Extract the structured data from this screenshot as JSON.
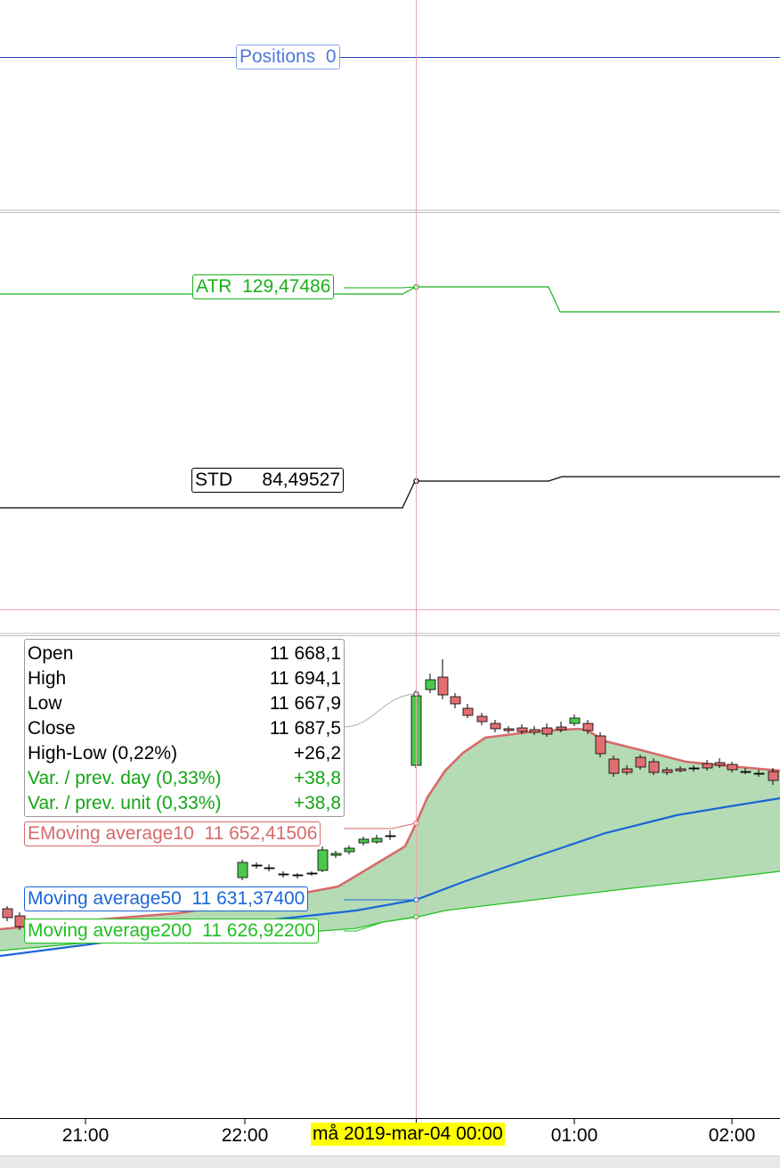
{
  "colors": {
    "positions": "#4f79d8",
    "atr": "#19b219",
    "std": "#000000",
    "ema10": "#d76a6a",
    "ma50": "#1a66d6",
    "ma200": "#1fbf1f",
    "fill": "#b5dbb5",
    "bull": "#4cc84c",
    "bear": "#e06f72",
    "crosshair": "#e7a8b4",
    "date_highlight": "#ffff00"
  },
  "panels": {
    "positions": {
      "label": "Positions",
      "value": "0"
    },
    "atr": {
      "label": "ATR",
      "value": "129,47486"
    },
    "std": {
      "label": "STD",
      "value": "84,49527"
    }
  },
  "ohlc_box": {
    "rows": [
      {
        "label": "Open",
        "value": "11 668,1",
        "style": "normal"
      },
      {
        "label": "High",
        "value": "11 694,1",
        "style": "normal"
      },
      {
        "label": "Low",
        "value": "11 667,9",
        "style": "normal"
      },
      {
        "label": "Close",
        "value": "11 687,5",
        "style": "normal"
      },
      {
        "label": "High-Low (0,22%)",
        "value": "+26,2",
        "style": "normal"
      },
      {
        "label": "Var. / prev. day (0,33%)",
        "value": "+38,8",
        "style": "green"
      },
      {
        "label": "Var. / prev. unit (0,33%)",
        "value": "+38,8",
        "style": "green"
      }
    ]
  },
  "indicators": {
    "ema10": {
      "label": "EMoving average10",
      "value": "11 652,41506"
    },
    "ma50": {
      "label": "Moving average50",
      "value": "11 631,37400"
    },
    "ma200": {
      "label": "Moving average200",
      "value": "11 626,92200"
    }
  },
  "time_axis": {
    "ticks": [
      "21:00",
      "22:00",
      "01:00",
      "02:00"
    ],
    "crosshair_date": "må 2019-mar-04 00:00"
  },
  "chart_data": {
    "type": "candlestick",
    "selected": {
      "open": 11668.1,
      "high": 11694.1,
      "low": 11667.9,
      "close": 11687.5
    },
    "series": [
      {
        "name": "EMoving average10",
        "value_at_cursor": 11652.41506
      },
      {
        "name": "Moving average50",
        "value_at_cursor": 11631.374
      },
      {
        "name": "Moving average200",
        "value_at_cursor": 11626.922
      },
      {
        "name": "ATR",
        "value_at_cursor": 129.47486
      },
      {
        "name": "STD",
        "value_at_cursor": 84.49527
      },
      {
        "name": "Positions",
        "value_at_cursor": 0
      }
    ]
  }
}
